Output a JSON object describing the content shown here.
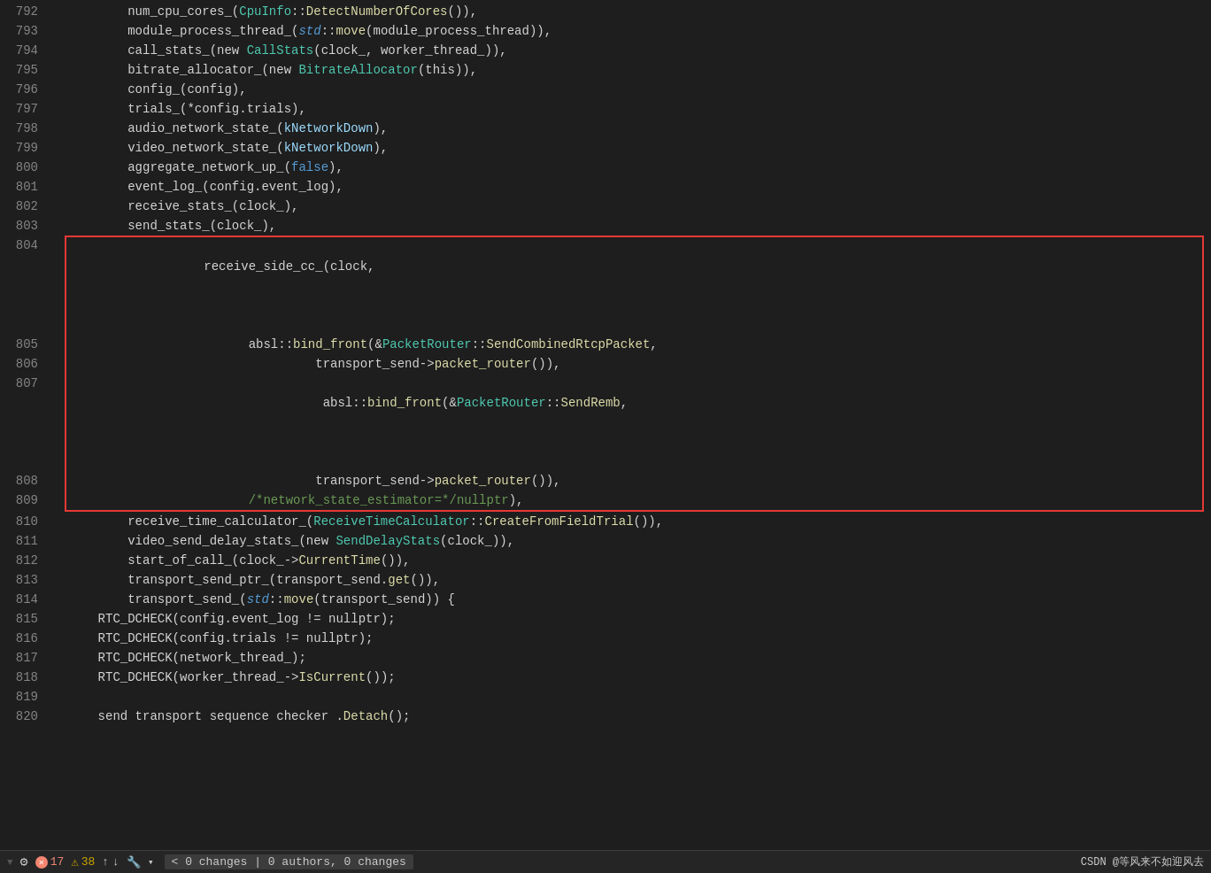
{
  "editor": {
    "background": "#1e1e1e",
    "lines": [
      {
        "num": "792",
        "content": [
          {
            "text": "        num_cpu_cores_(",
            "color": "plain"
          },
          {
            "text": "CpuInfo",
            "color": "type"
          },
          {
            "text": "::",
            "color": "plain"
          },
          {
            "text": "DetectNumberOfCores",
            "color": "fn"
          },
          {
            "text": "()),",
            "color": "plain"
          }
        ]
      },
      {
        "num": "793",
        "content": [
          {
            "text": "        module_process_thread_(",
            "color": "plain"
          },
          {
            "text": "std",
            "color": "italic_blue"
          },
          {
            "text": "::",
            "color": "plain"
          },
          {
            "text": "move",
            "color": "fn"
          },
          {
            "text": "(module_process_thread)),",
            "color": "plain"
          }
        ]
      },
      {
        "num": "794",
        "content": [
          {
            "text": "        call_stats_(new ",
            "color": "plain"
          },
          {
            "text": "CallStats",
            "color": "type"
          },
          {
            "text": "(clock_, worker_thread_)),",
            "color": "plain"
          }
        ]
      },
      {
        "num": "795",
        "content": [
          {
            "text": "        bitrate_allocator_(new ",
            "color": "plain"
          },
          {
            "text": "BitrateAllocator",
            "color": "type"
          },
          {
            "text": "(this)),",
            "color": "plain"
          }
        ]
      },
      {
        "num": "796",
        "content": [
          {
            "text": "        config_(config),",
            "color": "plain"
          }
        ]
      },
      {
        "num": "797",
        "content": [
          {
            "text": "        trials_(*config.trials),",
            "color": "plain"
          }
        ]
      },
      {
        "num": "798",
        "content": [
          {
            "text": "        audio_network_state_(",
            "color": "plain"
          },
          {
            "text": "kNetworkDown",
            "color": "light_blue"
          },
          {
            "text": "),",
            "color": "plain"
          }
        ]
      },
      {
        "num": "799",
        "content": [
          {
            "text": "        video_network_state_(",
            "color": "plain"
          },
          {
            "text": "kNetworkDown",
            "color": "light_blue"
          },
          {
            "text": "),",
            "color": "plain"
          }
        ]
      },
      {
        "num": "800",
        "content": [
          {
            "text": "        aggregate_network_up_(",
            "color": "plain"
          },
          {
            "text": "false",
            "color": "blue"
          },
          {
            "text": "),",
            "color": "plain"
          }
        ]
      },
      {
        "num": "801",
        "content": [
          {
            "text": "        event_log_(config.event_log),",
            "color": "plain"
          }
        ]
      },
      {
        "num": "802",
        "content": [
          {
            "text": "        receive_stats_(clock_),",
            "color": "plain"
          }
        ]
      },
      {
        "num": "803",
        "content": [
          {
            "text": "        send_stats_(clock_),",
            "color": "plain"
          }
        ]
      }
    ],
    "highlighted_lines": [
      {
        "num": "804",
        "content": [
          {
            "text": "        receive_side_cc_(",
            "color": "plain"
          },
          {
            "text": "clock",
            "color": "plain"
          },
          {
            "text": ",",
            "color": "plain"
          }
        ],
        "arrow": "right"
      },
      {
        "num": "805",
        "content": [
          {
            "text": "                        absl::",
            "color": "plain"
          },
          {
            "text": "bind_front",
            "color": "fn"
          },
          {
            "text": "(&",
            "color": "plain"
          },
          {
            "text": "PacketRouter",
            "color": "type"
          },
          {
            "text": "::",
            "color": "plain"
          },
          {
            "text": "SendCombinedRtcpPacket",
            "color": "fn"
          },
          {
            "text": ",",
            "color": "plain"
          }
        ]
      },
      {
        "num": "806",
        "content": [
          {
            "text": "                                 transport_send->",
            "color": "plain"
          },
          {
            "text": "packet_router",
            "color": "fn"
          },
          {
            "text": "()),",
            "color": "plain"
          }
        ]
      },
      {
        "num": "807",
        "content": [
          {
            "text": "                        absl::",
            "color": "plain"
          },
          {
            "text": "bind_front",
            "color": "fn"
          },
          {
            "text": "(&",
            "color": "plain"
          },
          {
            "text": "PacketRouter",
            "color": "type"
          },
          {
            "text": "::",
            "color": "plain"
          },
          {
            "text": "SendRemb",
            "color": "fn"
          },
          {
            "text": ",",
            "color": "plain"
          }
        ],
        "arrow": "left"
      },
      {
        "num": "808",
        "content": [
          {
            "text": "                                 transport_send->",
            "color": "plain"
          },
          {
            "text": "packet_router",
            "color": "fn"
          },
          {
            "text": "()),",
            "color": "plain"
          }
        ]
      },
      {
        "num": "809",
        "content": [
          {
            "text": "                        ",
            "color": "plain"
          },
          {
            "text": "/*network_state_estimator=*/nullptr",
            "color": "cm"
          },
          {
            "text": "),",
            "color": "plain"
          }
        ]
      }
    ],
    "after_lines": [
      {
        "num": "810",
        "content": [
          {
            "text": "        receive_time_calculator_(",
            "color": "plain"
          },
          {
            "text": "ReceiveTimeCalculator",
            "color": "type"
          },
          {
            "text": "::",
            "color": "plain"
          },
          {
            "text": "CreateFromFieldTrial",
            "color": "fn"
          },
          {
            "text": "()),",
            "color": "plain"
          }
        ]
      },
      {
        "num": "811",
        "content": [
          {
            "text": "        video_send_delay_stats_(new ",
            "color": "plain"
          },
          {
            "text": "SendDelayStats",
            "color": "type"
          },
          {
            "text": "(clock_)),",
            "color": "plain"
          }
        ]
      },
      {
        "num": "812",
        "content": [
          {
            "text": "        start_of_call_(clock_->",
            "color": "plain"
          },
          {
            "text": "CurrentTime",
            "color": "fn"
          },
          {
            "text": "()),",
            "color": "plain"
          }
        ]
      },
      {
        "num": "813",
        "content": [
          {
            "text": "        transport_send_ptr_(transport_send.",
            "color": "plain"
          },
          {
            "text": "get",
            "color": "fn"
          },
          {
            "text": "()),",
            "color": "plain"
          }
        ]
      },
      {
        "num": "814",
        "content": [
          {
            "text": "        transport_send_(",
            "color": "plain"
          },
          {
            "text": "std",
            "color": "italic_blue"
          },
          {
            "text": "::",
            "color": "plain"
          },
          {
            "text": "move",
            "color": "fn"
          },
          {
            "text": "(transport_send)) {",
            "color": "plain"
          }
        ]
      },
      {
        "num": "815",
        "content": [
          {
            "text": "    RTC_DCHECK(config.event_log != nullptr);",
            "color": "plain"
          }
        ]
      },
      {
        "num": "816",
        "content": [
          {
            "text": "    RTC_DCHECK(config.trials != nullptr);",
            "color": "plain"
          }
        ]
      },
      {
        "num": "817",
        "content": [
          {
            "text": "    RTC_DCHECK(network_thread_);",
            "color": "plain"
          }
        ]
      },
      {
        "num": "818",
        "content": [
          {
            "text": "    RTC_DCHECK(worker_thread_->",
            "color": "plain"
          },
          {
            "text": "IsCurrent",
            "color": "fn"
          },
          {
            "text": "());",
            "color": "plain"
          }
        ]
      },
      {
        "num": "819",
        "content": []
      },
      {
        "num": "820",
        "content": [
          {
            "text": "    send transport sequence checker .",
            "color": "plain"
          },
          {
            "text": "Detach",
            "color": "fn"
          },
          {
            "text": "();",
            "color": "plain"
          }
        ]
      }
    ]
  },
  "statusbar": {
    "errors_icon": "✕",
    "errors_count": "17",
    "warnings_count": "38",
    "arrow_up": "↑",
    "arrow_down": "↓",
    "wrench_icon": "🔧",
    "dropdown_arrow": "▾",
    "git_label": "< 0 changes | 0 authors, 0 changes",
    "brand": "CSDN @等风来不如迎风去"
  }
}
